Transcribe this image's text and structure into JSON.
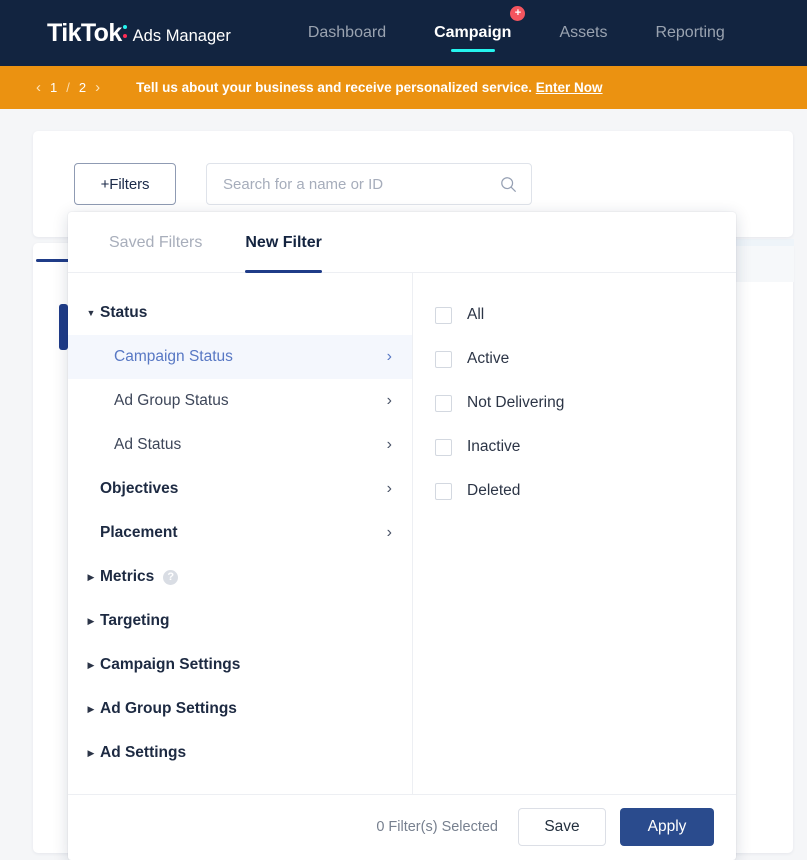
{
  "brand": {
    "name": "TikTok",
    "colon_icon": "colon-dots-icon",
    "product": "Ads Manager",
    "dot_top_color": "#25f4ee",
    "dot_bottom_color": "#fe2c55"
  },
  "nav": {
    "items": [
      {
        "label": "Dashboard",
        "active": false,
        "badge": null
      },
      {
        "label": "Campaign",
        "active": true,
        "badge": "+"
      },
      {
        "label": "Assets",
        "active": false,
        "badge": null
      },
      {
        "label": "Reporting",
        "active": false,
        "badge": null
      }
    ],
    "active_underline_color": "#25f4ee",
    "badge_color": "#f4555f",
    "bar_color": "#122440"
  },
  "banner": {
    "prev_icon": "chevron-left-icon",
    "next_icon": "chevron-right-icon",
    "current_page": "1",
    "separator": "/",
    "total_pages": "2",
    "message": "Tell us about your business and receive personalized service.",
    "link_label": "Enter Now",
    "background_color": "#eb9211"
  },
  "toolbar": {
    "filters_button_label": "+Filters",
    "search": {
      "placeholder": "Search for a name or ID",
      "value": "",
      "icon": "search-icon"
    }
  },
  "filter_panel": {
    "tabs": [
      {
        "label": "Saved Filters",
        "active": false
      },
      {
        "label": "New Filter",
        "active": true
      }
    ],
    "active_tab_underline_color": "#1f3c88",
    "categories": [
      {
        "label": "Status",
        "level": "group",
        "expanded": true,
        "toggle_icon": "triangle-down-icon",
        "chevron": false,
        "selected": false,
        "help": false
      },
      {
        "label": "Campaign Status",
        "level": "sub",
        "expanded": false,
        "toggle_icon": null,
        "chevron": true,
        "selected": true,
        "help": false
      },
      {
        "label": "Ad Group Status",
        "level": "sub",
        "expanded": false,
        "toggle_icon": null,
        "chevron": true,
        "selected": false,
        "help": false
      },
      {
        "label": "Ad Status",
        "level": "sub",
        "expanded": false,
        "toggle_icon": null,
        "chevron": true,
        "selected": false,
        "help": false
      },
      {
        "label": "Objectives",
        "level": "group-flat",
        "expanded": false,
        "toggle_icon": null,
        "chevron": true,
        "selected": false,
        "help": false
      },
      {
        "label": "Placement",
        "level": "group-flat",
        "expanded": false,
        "toggle_icon": null,
        "chevron": true,
        "selected": false,
        "help": false
      },
      {
        "label": "Metrics",
        "level": "group",
        "expanded": false,
        "toggle_icon": "triangle-right-icon",
        "chevron": false,
        "selected": false,
        "help": true,
        "help_icon": "help-circle-icon",
        "help_glyph": "?"
      },
      {
        "label": "Targeting",
        "level": "group",
        "expanded": false,
        "toggle_icon": "triangle-right-icon",
        "chevron": false,
        "selected": false,
        "help": false
      },
      {
        "label": "Campaign Settings",
        "level": "group",
        "expanded": false,
        "toggle_icon": "triangle-right-icon",
        "chevron": false,
        "selected": false,
        "help": false
      },
      {
        "label": "Ad Group Settings",
        "level": "group",
        "expanded": false,
        "toggle_icon": "triangle-right-icon",
        "chevron": false,
        "selected": false,
        "help": false
      },
      {
        "label": "Ad Settings",
        "level": "group",
        "expanded": false,
        "toggle_icon": "triangle-right-icon",
        "chevron": false,
        "selected": false,
        "help": false
      }
    ],
    "options": [
      {
        "label": "All",
        "checked": false
      },
      {
        "label": "Active",
        "checked": false
      },
      {
        "label": "Not Delivering",
        "checked": false
      },
      {
        "label": "Inactive",
        "checked": false
      },
      {
        "label": "Deleted",
        "checked": false
      }
    ],
    "footer": {
      "selected_count_text": "0 Filter(s) Selected",
      "save_label": "Save",
      "apply_label": "Apply",
      "apply_color": "#2a4b8d"
    }
  }
}
